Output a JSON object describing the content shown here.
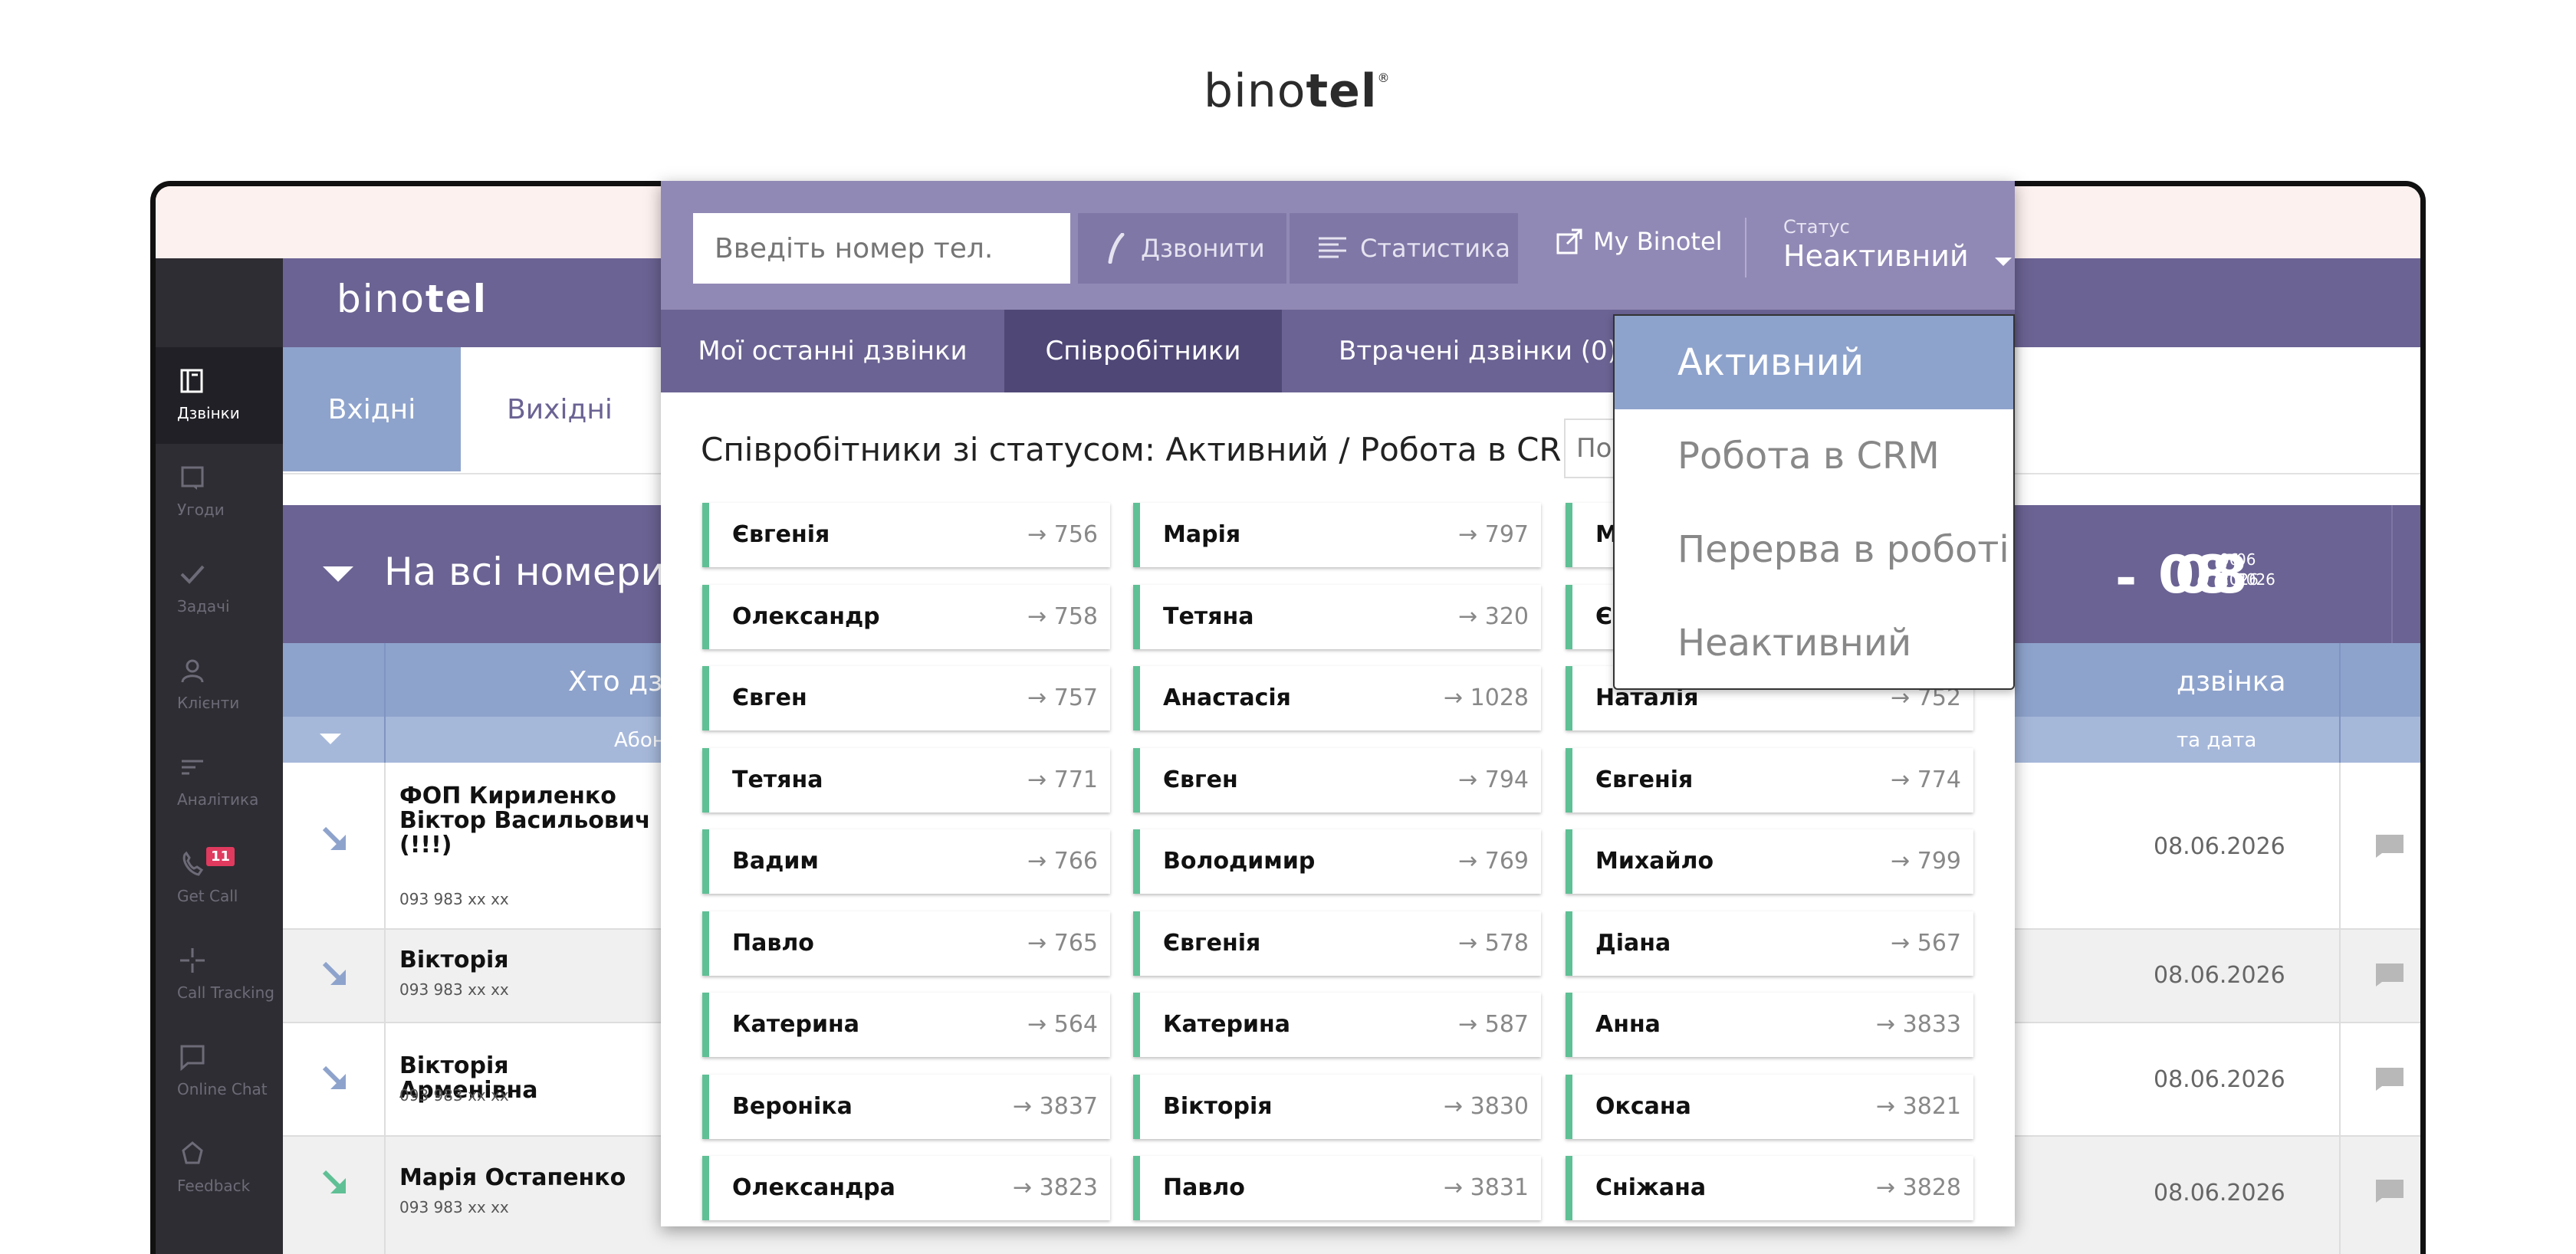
{
  "brand": {
    "name_light": "bino",
    "name_bold": "tel",
    "reg": "®"
  },
  "sidebar": {
    "items": [
      {
        "label": "Дзвінки",
        "icon": "book-icon"
      },
      {
        "label": "Угоди",
        "icon": "deal-icon"
      },
      {
        "label": "Задачі",
        "icon": "check-icon"
      },
      {
        "label": "Клієнти",
        "icon": "user-icon"
      },
      {
        "label": "Аналітика",
        "icon": "analytics-icon"
      },
      {
        "label": "Get Call",
        "icon": "phone-icon",
        "badge": "11"
      },
      {
        "label": "Call Tracking",
        "icon": "tracking-icon"
      },
      {
        "label": "Online Chat",
        "icon": "chat-icon"
      },
      {
        "label": "Feedback",
        "icon": "feedback-icon"
      }
    ]
  },
  "app": {
    "tabs": [
      {
        "label": "Вхідні"
      },
      {
        "label": "Вихідні"
      }
    ],
    "filter_title": "На всі номери",
    "date_from": {
      "day": "08",
      "month": "06",
      "year": "2026"
    },
    "date_to": {
      "day": "08",
      "month": "06",
      "year": "2026"
    },
    "date_dash": "-",
    "grid_head_left": "Хто дзв",
    "grid_head_right": "дзвінка",
    "grid_sub_left": "Абон",
    "grid_sub_right": "та дата",
    "rows": [
      {
        "name": "ФОП Кириленко Віктор Васильович (!!!)",
        "phone": "093 983 xx xx",
        "date": "08.06.2026"
      },
      {
        "name": "Вікторія",
        "phone": "093 983 xx xx",
        "date": "08.06.2026"
      },
      {
        "name": "Вікторія Арменівна",
        "phone": "093 983 xx xx",
        "date": "08.06.2026"
      },
      {
        "name": "Марія Остапенко",
        "phone": "093 983 xx xx",
        "date": "08.06.2026"
      }
    ]
  },
  "widget": {
    "phone_placeholder": "Введіть номер тел.",
    "call_button": "Дзвонити",
    "stats_button": "Статистика",
    "my_binotel": "My Binotel",
    "status_label": "Статус",
    "status_value": "Неактивний",
    "tabs": [
      {
        "label": "Мої останні дзвінки"
      },
      {
        "label": "Співробітники"
      },
      {
        "label": "Втрачені дзвінки (0)"
      }
    ],
    "employees_title": "Співробітники зі статусом: Активний / Робота в CRM",
    "search_placeholder": "По",
    "employees": [
      [
        {
          "name": "Євгенія",
          "ext": "→ 756"
        },
        {
          "name": "Марія",
          "ext": "→ 797"
        },
        {
          "name": "М",
          "ext": ""
        }
      ],
      [
        {
          "name": "Олександр",
          "ext": "→ 758"
        },
        {
          "name": "Тетяна",
          "ext": "→ 320"
        },
        {
          "name": "Є",
          "ext": ""
        }
      ],
      [
        {
          "name": "Євген",
          "ext": "→ 757"
        },
        {
          "name": "Анастасія",
          "ext": "→ 1028"
        },
        {
          "name": "Наталія",
          "ext": "→ 752"
        }
      ],
      [
        {
          "name": "Тетяна",
          "ext": "→ 771"
        },
        {
          "name": "Євген",
          "ext": "→ 794"
        },
        {
          "name": "Євгенія",
          "ext": "→ 774"
        }
      ],
      [
        {
          "name": "Вадим",
          "ext": "→ 766"
        },
        {
          "name": "Володимир",
          "ext": "→ 769"
        },
        {
          "name": "Михайло",
          "ext": "→ 799"
        }
      ],
      [
        {
          "name": "Павло",
          "ext": "→ 765"
        },
        {
          "name": "Євгенія",
          "ext": "→ 578"
        },
        {
          "name": "Діана",
          "ext": "→ 567"
        }
      ],
      [
        {
          "name": "Катерина",
          "ext": "→ 564"
        },
        {
          "name": "Катерина",
          "ext": "→ 587"
        },
        {
          "name": "Анна",
          "ext": "→ 3833"
        }
      ],
      [
        {
          "name": "Вероніка",
          "ext": "→ 3837"
        },
        {
          "name": "Вікторія",
          "ext": "→ 3830"
        },
        {
          "name": "Оксана",
          "ext": "→ 3821"
        }
      ],
      [
        {
          "name": "Олександра",
          "ext": "→ 3823"
        },
        {
          "name": "Павло",
          "ext": "→ 3831"
        },
        {
          "name": "Сніжана",
          "ext": "→ 3828"
        }
      ]
    ],
    "status_options": [
      {
        "label": "Активний"
      },
      {
        "label": "Робота в CRM"
      },
      {
        "label": "Перерва в роботі"
      },
      {
        "label": "Неактивний"
      }
    ]
  },
  "colors": {
    "accent": "#6b6393",
    "light_accent": "#8ea3cc",
    "online": "#5fc095",
    "badge": "#e03a5f"
  }
}
